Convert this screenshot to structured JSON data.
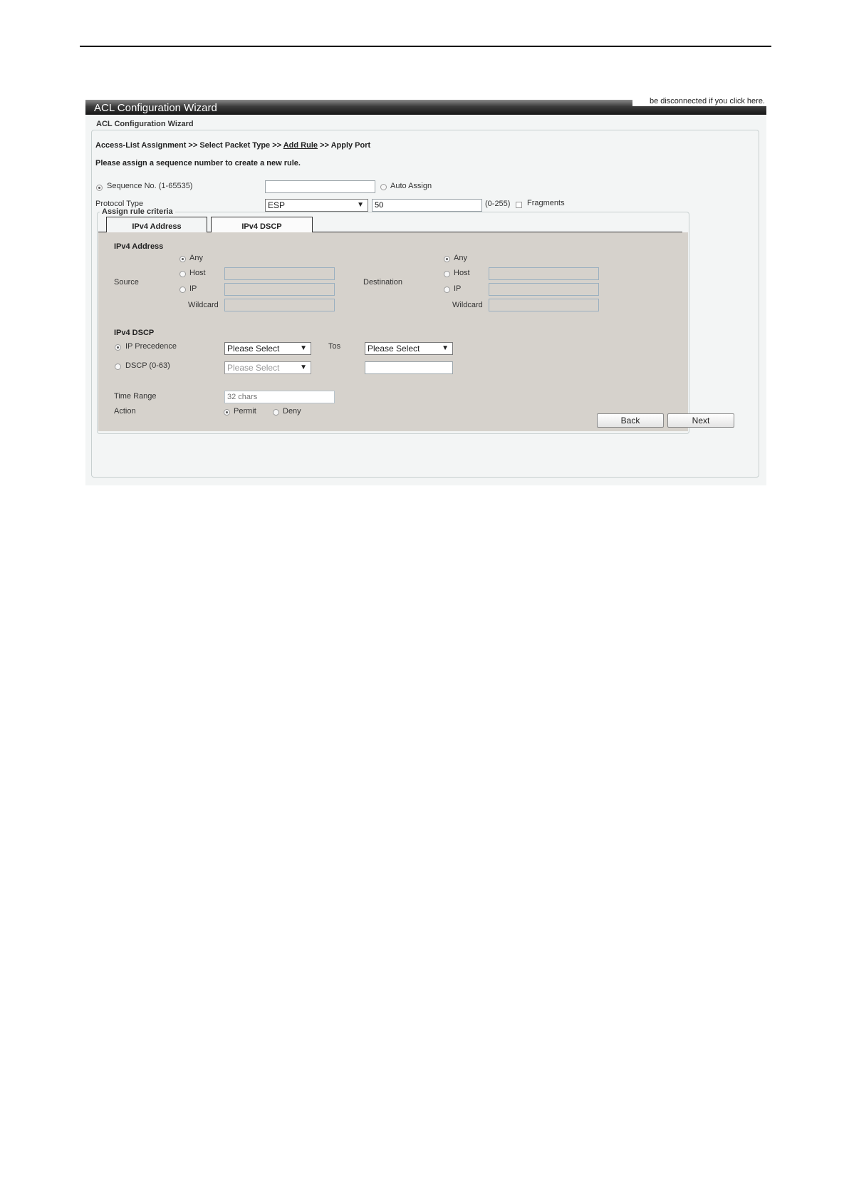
{
  "window": {
    "title": "ACL Configuration Wizard",
    "notice": "be disconnected if you click here."
  },
  "wizard": {
    "legend": "ACL Configuration Wizard",
    "breadcrumb": {
      "step1": "Access-List Assignment >> Select Packet Type >>",
      "step_current": "Add Rule",
      "step_last": ">> Apply Port"
    },
    "instruction": "Please assign a sequence number to create a new rule.",
    "sequence": {
      "label": "Sequence No. (1-65535)",
      "value": "",
      "selected": true
    },
    "auto_assign": {
      "label": "Auto Assign",
      "selected": false
    },
    "protocol": {
      "label": "Protocol Type",
      "selected": "ESP",
      "number": "50",
      "range": "(0-255)",
      "fragments_label": "Fragments",
      "fragments_checked": false
    }
  },
  "criteria": {
    "legend": "Assign rule criteria",
    "tabs": [
      {
        "label": "IPv4 Address",
        "active": false
      },
      {
        "label": "IPv4 DSCP",
        "active": true
      }
    ],
    "ipv4_address": {
      "heading": "IPv4 Address",
      "source": {
        "label": "Source",
        "any": "Any",
        "host": "Host",
        "ip": "IP",
        "wildcard": "Wildcard",
        "selected": "any"
      },
      "destination": {
        "label": "Destination",
        "any": "Any",
        "host": "Host",
        "ip": "IP",
        "wildcard": "Wildcard",
        "selected": "any"
      }
    },
    "ipv4_dscp": {
      "heading": "IPv4 DSCP",
      "ip_precedence": {
        "label": "IP Precedence",
        "select": "Please Select",
        "selected": true
      },
      "tos": {
        "label": "Tos",
        "select": "Please Select"
      },
      "dscp": {
        "label": "DSCP (0-63)",
        "select": "Please Select",
        "selected": false,
        "value": ""
      }
    },
    "time_range": {
      "label": "Time Range",
      "placeholder": "32 chars"
    },
    "action": {
      "label": "Action",
      "permit": "Permit",
      "deny": "Deny",
      "selected": "permit"
    },
    "buttons": {
      "back": "Back",
      "next": "Next"
    }
  },
  "colors": {
    "panel_bg": "#d6d2cc",
    "window_bg": "#f3f5f5",
    "titlebar_dark": "#161616"
  }
}
